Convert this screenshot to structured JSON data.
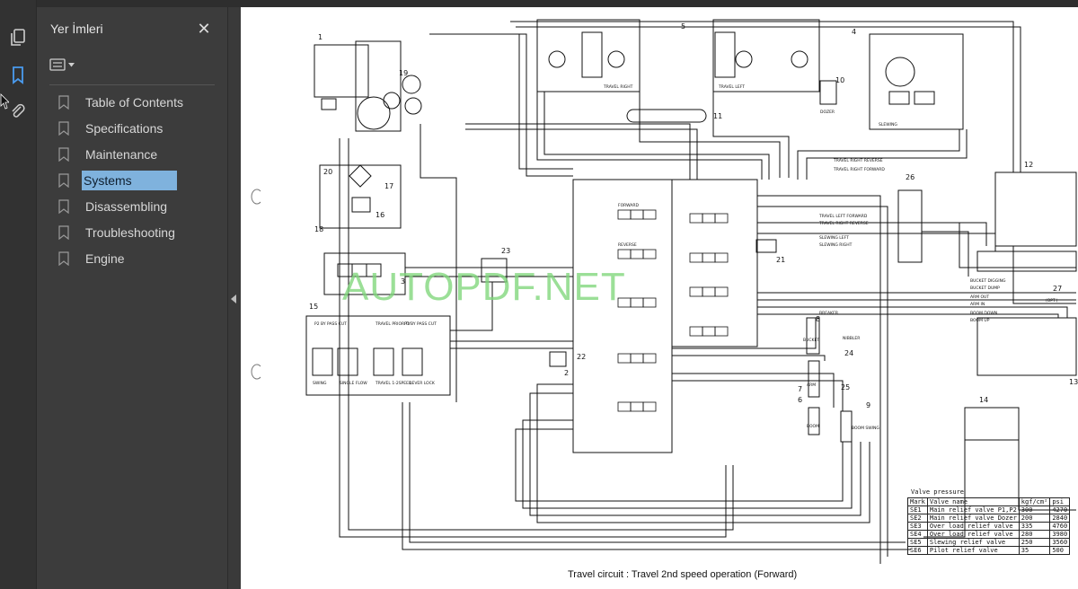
{
  "sidebar_panel": {
    "title": "Yer İmleri",
    "bookmarks": [
      {
        "label": "Table of Contents",
        "selected": false
      },
      {
        "label": "Specifications",
        "selected": false
      },
      {
        "label": "Maintenance",
        "selected": false
      },
      {
        "label": "Systems",
        "selected": true
      },
      {
        "label": "Disassembling",
        "selected": false
      },
      {
        "label": "Troubleshooting",
        "selected": false
      },
      {
        "label": "Engine",
        "selected": false
      }
    ]
  },
  "document": {
    "watermark": "AUTOPDF.NET",
    "caption": "Travel circuit : Travel 2nd speed operation (Forward)",
    "component_numbers": [
      "1",
      "2",
      "3",
      "4",
      "5",
      "6",
      "7",
      "8",
      "9",
      "10",
      "11",
      "12",
      "13",
      "14",
      "15",
      "16",
      "17",
      "18",
      "19",
      "20",
      "21",
      "22",
      "23",
      "24",
      "25",
      "26",
      "27"
    ],
    "labels": {
      "travel_right": "TRAVEL RIGHT",
      "travel_left": "TRAVEL LEFT",
      "dozer": "DOZER",
      "slewing": "SLEWING",
      "travel_right_reverse": "TRAVEL RIGHT REVERSE",
      "travel_right_forward": "TRAVEL RIGHT FORWARD",
      "travel_left_forward": "TRAVEL LEFT FORWARD",
      "travel_left_reverse": "TRAVEL LEFT REVERSE",
      "slewing_left": "SLEWING LEFT",
      "slewing_right": "SLEWING RIGHT",
      "bucket_digging": "BUCKET DIGGING",
      "bucket_dump": "BUCKET DUMP",
      "arm_out": "ARM OUT",
      "arm_in": "ARM IN",
      "boom_down": "BOOM DOWN",
      "boom_up": "BOOM UP",
      "breaker": "BREAKER",
      "nibbler": "NIBBLER",
      "bucket": "BUCKET",
      "arm": "ARM",
      "boom": "BOOM",
      "boom_swing": "BOOM SWING",
      "opt": "(OPT.)",
      "swing_parking_brake": "SWING PARKING BRAKE",
      "single_flow_conflux_changeover": "SINGLE FLOW CONFLUX CHANGEOVER",
      "travel_2speed_changeover": "TRAVEL 1-2SPEED CHANGEOVER",
      "lever_lock": "LEVER LOCK",
      "p2_by_pass_cut": "P2 BY PASS CUT",
      "travel_priority": "TRAVEL PRIORITY",
      "p1_by_pass_cut_arm_conflux": "P1 BY PASS CUT & ARM CONFLUX",
      "forward": "FORWARD",
      "reverse": "REVERSE"
    },
    "valve_pressure": {
      "title": "Valve pressure",
      "headers": [
        "Mark",
        "Valve name",
        "kgf/cm²",
        "psi"
      ],
      "rows": [
        [
          "SE1",
          "Main relief valve P1,P2",
          "300",
          "4270"
        ],
        [
          "SE2",
          "Main relief valve Dozer",
          "200",
          "2840"
        ],
        [
          "SE3",
          "Over load relief valve",
          "335",
          "4760"
        ],
        [
          "SE4",
          "Over load relief valve",
          "280",
          "3980"
        ],
        [
          "SE5",
          "Slewing relief valve",
          "250",
          "3560"
        ],
        [
          "SE6",
          "Pilot relief valve",
          "35",
          "500"
        ]
      ]
    }
  },
  "colors": {
    "accent": "#7fb2dd",
    "icon_blue": "#4a9cf0",
    "watermark": "#7fd77a"
  }
}
